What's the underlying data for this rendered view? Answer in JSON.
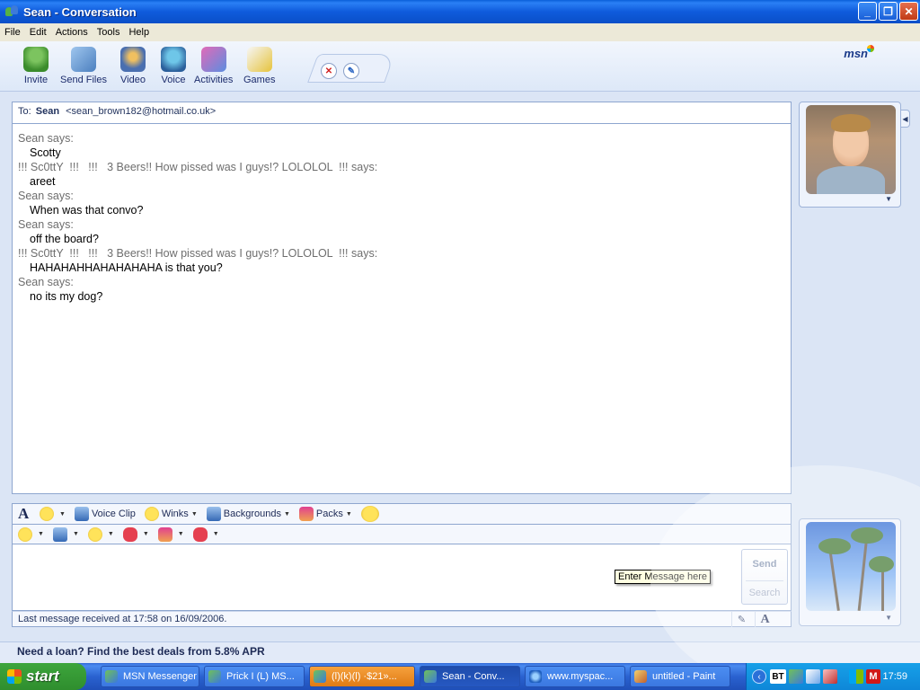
{
  "window": {
    "title": "Sean - Conversation"
  },
  "menu": [
    "File",
    "Edit",
    "Actions",
    "Tools",
    "Help"
  ],
  "toolbar": {
    "invite": "Invite",
    "send_files": "Send Files",
    "video": "Video",
    "voice": "Voice",
    "activities": "Activities",
    "games": "Games",
    "brand": "msn"
  },
  "to": {
    "label": "To:",
    "name": "Sean",
    "email": "<sean_brown182@hotmail.co.uk>"
  },
  "conversation": [
    {
      "sender": "Sean says:",
      "text": "Scotty"
    },
    {
      "sender": "!!! Sc0ttY  !!!   !!!   3 Beers!! How pissed was I guys!? LOLOLOL  !!! says:",
      "text": "areet"
    },
    {
      "sender": "Sean says:",
      "text": "When was that convo?"
    },
    {
      "sender": "Sean says:",
      "text": "off the board?"
    },
    {
      "sender": "!!! Sc0ttY  !!!   !!!   3 Beers!! How pissed was I guys!? LOLOLOL  !!! says:",
      "text": "HAHAHAHHAHAHAHAHA is that you?"
    },
    {
      "sender": "Sean says:",
      "text": "no its my dog?"
    }
  ],
  "format_bar": {
    "voice_clip": "Voice Clip",
    "winks": "Winks",
    "backgrounds": "Backgrounds",
    "packs": "Packs"
  },
  "input": {
    "send": "Send",
    "search": "Search",
    "tooltip": "Enter Message here"
  },
  "status": {
    "last_message": "Last message received at 17:58 on 16/09/2006."
  },
  "ad": {
    "text": "Need a loan? Find the best deals from 5.8% APR"
  },
  "taskbar": {
    "start": "start",
    "tasks": [
      "MSN Messenger",
      "Prick I (L) MS...",
      "(l)(k)(l) ·$21»...",
      "Sean - Conv...",
      "www.myspac...",
      "untitled - Paint"
    ],
    "tray_label": "BT",
    "clock": "17:59"
  }
}
